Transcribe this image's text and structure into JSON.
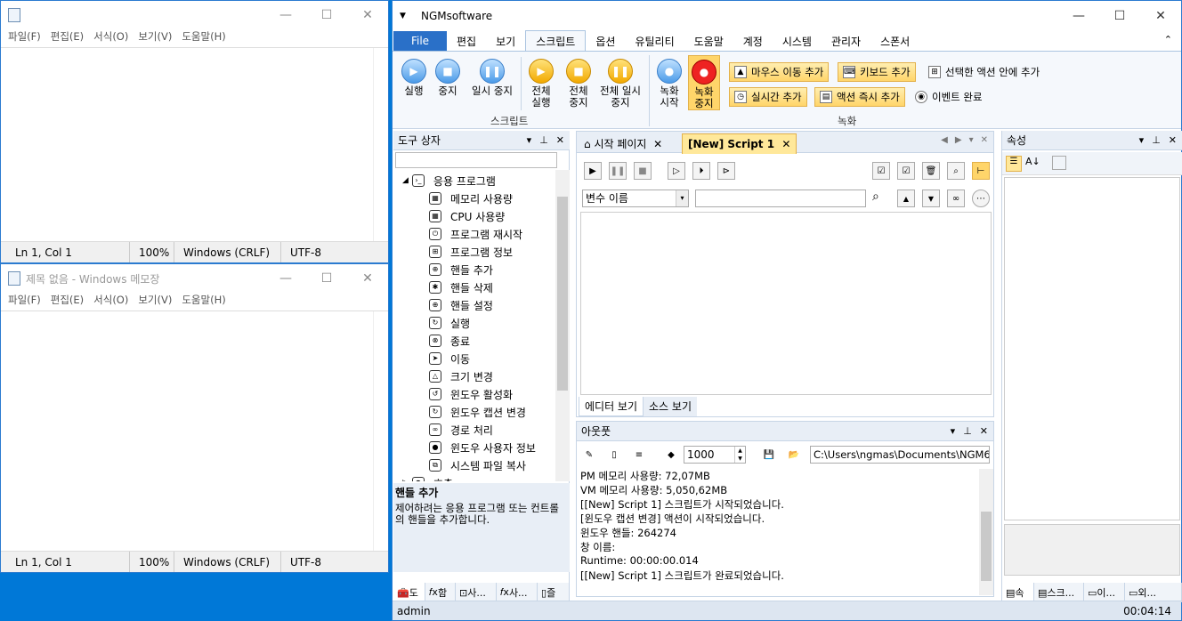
{
  "notepad1": {
    "title": "",
    "menu": [
      "파일(F)",
      "편집(E)",
      "서식(O)",
      "보기(V)",
      "도움말(H)"
    ],
    "status": {
      "pos": "Ln 1, Col 1",
      "zoom": "100%",
      "eol": "Windows (CRLF)",
      "enc": "UTF-8"
    }
  },
  "notepad2": {
    "title": "제목 없음 - Windows 메모장",
    "menu": [
      "파일(F)",
      "편집(E)",
      "서식(O)",
      "보기(V)",
      "도움말(H)"
    ],
    "status": {
      "pos": "Ln 1, Col 1",
      "zoom": "100%",
      "eol": "Windows (CRLF)",
      "enc": "UTF-8"
    }
  },
  "ngm": {
    "title": "NGMsoftware",
    "tabs": [
      "File",
      "편집",
      "보기",
      "스크립트",
      "옵션",
      "유틸리티",
      "도움말",
      "계정",
      "시스템",
      "관리자",
      "스폰서"
    ],
    "ribbon": {
      "run": "실행",
      "stop": "중지",
      "pause": "일시 중지",
      "run_all": "전체 실행",
      "stop_all": "전체 중지",
      "pause_all": "전체 일시 중지",
      "script_group": "스크립트",
      "rec_start": "녹화 시작",
      "rec_stop": "녹화 중지",
      "mouse_move": "마우스 이동 추가",
      "keyboard": "키보드 추가",
      "in_selected": "선택한 액션 안에 추가",
      "realtime": "실시간 추가",
      "action_now": "액션 즉시 추가",
      "event_done": "이벤트 완료",
      "rec_group": "녹화"
    },
    "toolbox": {
      "title": "도구 상자",
      "root": "응용 프로그램",
      "items": [
        "메모리 사용량",
        "CPU 사용량",
        "프로그램 재시작",
        "프로그램 정보",
        "핸들 추가",
        "핸들 삭제",
        "핸들 설정",
        "실행",
        "종료",
        "이동",
        "크기 변경",
        "윈도우 활성화",
        "윈도우 캡션 변경",
        "경로 처리",
        "윈도우 사용자 정보",
        "시스템 파일 복사"
      ],
      "next": "호출",
      "desc_title": "핸들 추가",
      "desc": "제어하려는 응용 프로그램 또는 컨트롤의 핸들을 추가합니다.",
      "bottom_tabs": [
        "도",
        "함",
        "사...",
        "사...",
        "즐"
      ]
    },
    "editor": {
      "tab1": "시작 페이지",
      "tab2": "[New] Script 1",
      "var_placeholder": "변수 이름",
      "view_tabs": [
        "에디터 보기",
        "소스 보기"
      ]
    },
    "output": {
      "title": "아웃풋",
      "count": "1000",
      "path": "C:\\Users\\ngmas\\Documents\\NGM6\\",
      "lines": [
        "PM 메모리 사용량: 72,07MB",
        "VM 메모리 사용량: 5,050,62MB",
        "[[New] Script 1] 스크립트가 시작되었습니다.",
        "[윈도우 캡션 변경] 액션이 시작되었습니다.",
        "윈도우 핸들: 264274",
        "창 이름:",
        "Runtime: 00:00:00.014",
        "[[New] Script 1] 스크립트가 완료되었습니다."
      ]
    },
    "props": {
      "title": "속성",
      "bottom_tabs": [
        "속",
        "스크...",
        "이...",
        "외..."
      ]
    },
    "status": {
      "user": "admin",
      "time": "00:04:14"
    }
  }
}
